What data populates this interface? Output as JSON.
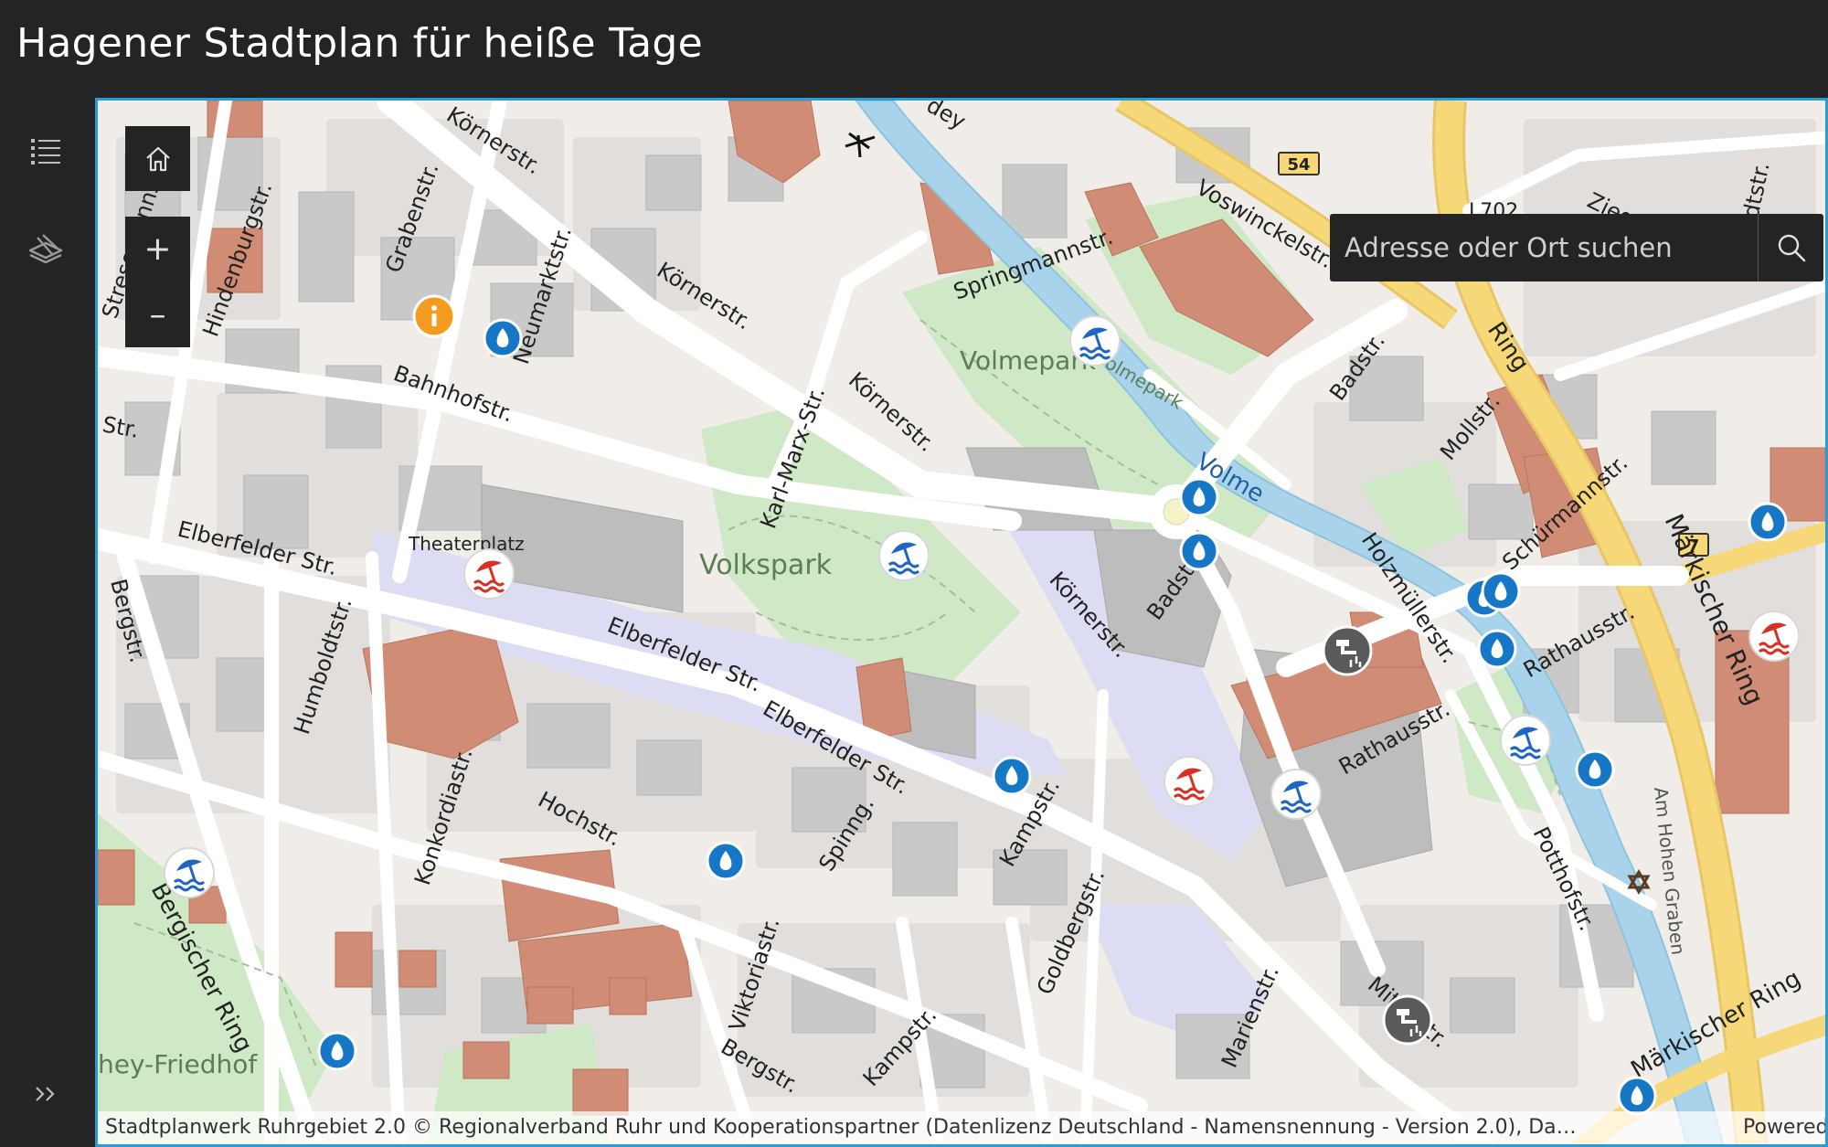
{
  "app": {
    "title": "Hagener Stadtplan für heiße Tage"
  },
  "sidebar": {
    "items": [
      {
        "name": "legend-list-icon"
      },
      {
        "name": "layers-icon"
      },
      {
        "name": "expand-icon"
      }
    ]
  },
  "map_controls": {
    "home": "home-icon",
    "zoom_in": "+",
    "zoom_out": "–"
  },
  "search": {
    "placeholder": "Adresse oder Ort suchen"
  },
  "attribution": {
    "text": "Stadtplanwerk Ruhrgebiet 2.0 © Regionalverband Ruhr und Kooperationspartner (Datenlizenz Deutschland - Namensnennung - Version 2.0), Da…",
    "powered": "Powered"
  },
  "colors": {
    "accent": "#2a9bd4",
    "water_icon": "#1677c7",
    "bathing_icon": "#1f66c2",
    "shade_icon": "#d93025",
    "fountain_icon": "#5a5a5a",
    "info_icon": "#f39c1f",
    "road_major": "#f6d878",
    "river": "#a8d3ea",
    "park": "#cfe8c5",
    "building": "#c8c8c8",
    "church": "#cf8c73",
    "pedestrian": "#ddddf3"
  },
  "map": {
    "street_labels": [
      {
        "text": "Körnerstr."
      },
      {
        "text": "Körnerstr."
      },
      {
        "text": "Körnerstr."
      },
      {
        "text": "Körnerstr."
      },
      {
        "text": "Grabenstr."
      },
      {
        "text": "Hindenburgstr."
      },
      {
        "text": "Stresemannstr."
      },
      {
        "text": "Neumarktstr."
      },
      {
        "text": "Bahnhofstr."
      },
      {
        "text": "Str."
      },
      {
        "text": "Elberfelder Str."
      },
      {
        "text": "Theaterplatz"
      },
      {
        "text": "Elberfelder Str."
      },
      {
        "text": "Elberfelder Str."
      },
      {
        "text": "Bergstr."
      },
      {
        "text": "Humboldtstr."
      },
      {
        "text": "Konkordiastr."
      },
      {
        "text": "Hochstr."
      },
      {
        "text": "Spinng."
      },
      {
        "text": "Karl-Marx-Str."
      },
      {
        "text": "Springmannstr."
      },
      {
        "text": "Voswinckelstr."
      },
      {
        "text": "Badstr."
      },
      {
        "text": "Badstr."
      },
      {
        "text": "Mollstr."
      },
      {
        "text": "Schürmannstr."
      },
      {
        "text": "Holzmüllerstr."
      },
      {
        "text": "Rathausstr."
      },
      {
        "text": "Rathausstr."
      },
      {
        "text": "Märkischer Ring"
      },
      {
        "text": "Märkischer Ring"
      },
      {
        "text": "Am Hohen Graben"
      },
      {
        "text": "Potthofstr."
      },
      {
        "text": "Mittelstr."
      },
      {
        "text": "Marienstr."
      },
      {
        "text": "Goldbergstr."
      },
      {
        "text": "Kampstr."
      },
      {
        "text": "Kampstr."
      },
      {
        "text": "Viktoriastr."
      },
      {
        "text": "Bergstr."
      },
      {
        "text": "Bergischer Ring"
      },
      {
        "text": "Volme"
      },
      {
        "text": "Volmepark"
      },
      {
        "text": "Volmepark"
      },
      {
        "text": "Volkspark"
      },
      {
        "text": "hey-Friedhof"
      },
      {
        "text": "Ring"
      },
      {
        "text": "Zieg"
      },
      {
        "text": "dtstr."
      },
      {
        "text": "dey"
      }
    ],
    "road_shields": [
      {
        "text": "54"
      },
      {
        "text": "7"
      },
      {
        "text": "L702"
      }
    ],
    "markers": [
      {
        "type": "info"
      },
      {
        "type": "water"
      },
      {
        "type": "water"
      },
      {
        "type": "water"
      },
      {
        "type": "water"
      },
      {
        "type": "water"
      },
      {
        "type": "water"
      },
      {
        "type": "water"
      },
      {
        "type": "water"
      },
      {
        "type": "water"
      },
      {
        "type": "water"
      },
      {
        "type": "water"
      },
      {
        "type": "water"
      },
      {
        "type": "bathing"
      },
      {
        "type": "bathing"
      },
      {
        "type": "bathing"
      },
      {
        "type": "bathing"
      },
      {
        "type": "bathing"
      },
      {
        "type": "shade"
      },
      {
        "type": "shade"
      },
      {
        "type": "shade"
      },
      {
        "type": "fountain"
      },
      {
        "type": "fountain"
      },
      {
        "type": "synagogue"
      }
    ]
  }
}
